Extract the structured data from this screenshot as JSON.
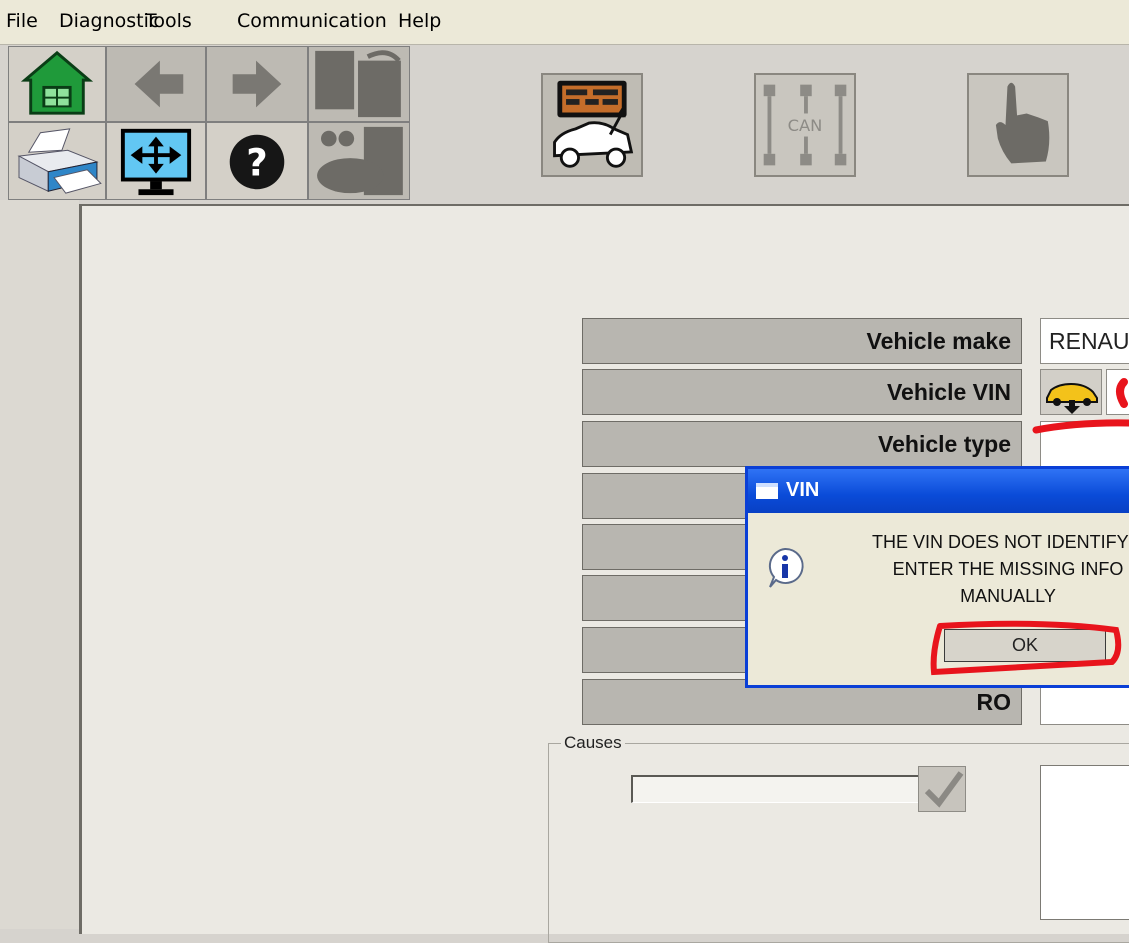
{
  "menu": [
    "File",
    "Diagnostic",
    "Tools",
    "Communication",
    "Help"
  ],
  "toolbar": {
    "can_label": "CAN"
  },
  "fields": [
    {
      "label": "Vehicle make",
      "value": "RENAU"
    },
    {
      "label": "Vehicle VIN",
      "value": ""
    },
    {
      "label": "Vehicle type",
      "value": ""
    },
    {
      "label": "",
      "value": ""
    },
    {
      "label": "",
      "value": ""
    },
    {
      "label": "",
      "value": ""
    },
    {
      "label": "",
      "value": ""
    },
    {
      "label": "RO",
      "value": ""
    }
  ],
  "causes": {
    "title": "Causes"
  },
  "dialog": {
    "title": "VIN",
    "message_line1": "THE VIN DOES NOT IDENTIFY T",
    "message_line2": "ENTER THE MISSING INFO",
    "message_line3": "MANUALLY",
    "ok_label": "OK"
  },
  "colors": {
    "annotation": "#e8141c",
    "title_bar": "#0a4bd8"
  }
}
